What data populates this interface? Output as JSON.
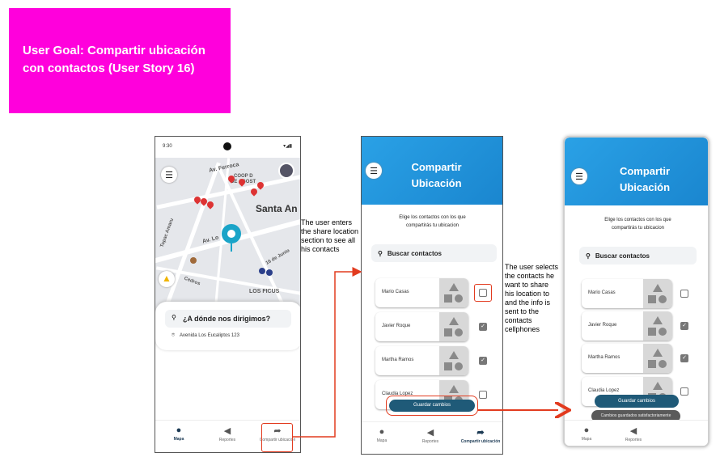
{
  "goal": {
    "line1": "User Goal: Compartir ubicación",
    "line2": "con contactos (User Story 16)"
  },
  "phone1": {
    "time": "9:30",
    "map_labels": {
      "street1": "Av. Ferroca",
      "coop": "COOP D",
      "agost": "DE AGOST",
      "santa": "Santa An",
      "tupac": "Tupac Amaru",
      "avlo": "Av. Lo",
      "jun": "16 de Junio",
      "cedros": "Cedros",
      "ficus": "LOS FICUS"
    },
    "question": "¿A dónde nos dirigimos?",
    "address": "Avenida Los Eucaliptos 123",
    "nav": {
      "mapa": "Mapa",
      "reportes": "Reportes",
      "compartir": "Compartir ubicación"
    }
  },
  "phone2": {
    "title_line1": "Compartir",
    "title_line2": "Ubicación",
    "subtitle_line1": "Elige los contactos con los que",
    "subtitle_line2": "compartirás tu ubicacion",
    "search": "Buscar contactos",
    "contacts": [
      "Mario Casas",
      "Javier Roque",
      "Martha Ramos",
      "Claudia Lopez"
    ],
    "save": "Guardar cambios",
    "nav": {
      "mapa": "Mapa",
      "reportes": "Reportes",
      "compartir": "Compartir ubicación"
    }
  },
  "phone3": {
    "title_line1": "Compartir",
    "title_line2": "Ubicación",
    "subtitle_line1": "Elige los contactos con los que",
    "subtitle_line2": "compartirás tu ubicacion",
    "search": "Buscar contactos",
    "contacts": [
      "Mario Casas",
      "Javier Roque",
      "Martha Ramos",
      "Claudia Lopez"
    ],
    "save": "Guardar cambios",
    "toast": "Cambios guardados satisfactoriamente",
    "nav": {
      "mapa": "Mapa",
      "reportes": "Reportes"
    }
  },
  "notes": {
    "note1": [
      "The user enters",
      "the share location",
      "section to see all",
      "his contacts"
    ],
    "note2": [
      "The user selects",
      "the contacts he",
      "want to share",
      "his location to",
      "and the info is",
      "sent to the",
      "contacts",
      "cellphones"
    ]
  },
  "colors": {
    "goal_bg": "#ff00dc",
    "accent_red": "#e23b1f",
    "hero_blue": "#2aa1e6",
    "save_btn": "#1f5a78"
  },
  "icons": [
    "hamburger-menu-icon",
    "search-icon",
    "location-pin-icon",
    "map-pin-icon",
    "megaphone-icon",
    "share-arrow-icon",
    "warning-icon",
    "check-icon"
  ]
}
